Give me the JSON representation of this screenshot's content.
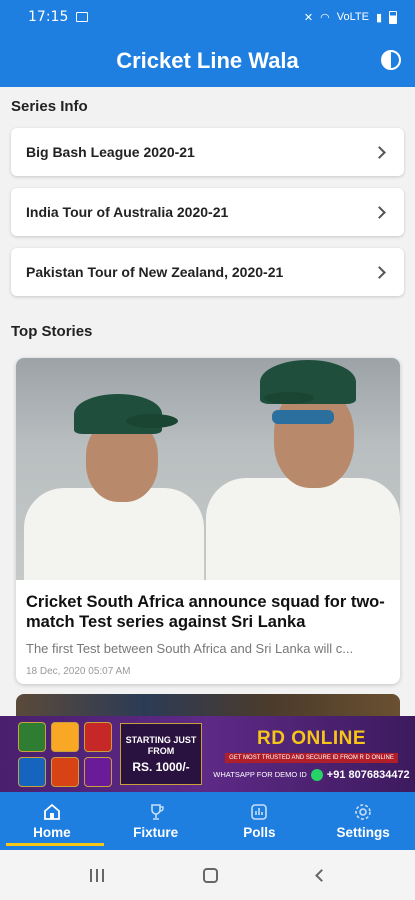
{
  "status_bar": {
    "time": "17:15",
    "network": "VoLTE",
    "battery_icon": "battery-icon"
  },
  "app": {
    "title": "Cricket Line Wala",
    "theme_toggle_icon": "contrast-icon"
  },
  "series_section": {
    "title": "Series Info",
    "items": [
      {
        "label": "Big Bash League 2020-21"
      },
      {
        "label": "India Tour of Australia 2020-21"
      },
      {
        "label": "Pakistan Tour of New Zealand, 2020-21"
      }
    ]
  },
  "stories_section": {
    "title": "Top Stories",
    "stories": [
      {
        "headline": "Cricket South Africa announce squad for two-match Test series against Sri Lanka",
        "summary": "The first Test between South Africa and Sri Lanka will c...",
        "date": "18 Dec, 2020  05:07 AM"
      }
    ]
  },
  "ad": {
    "mid_line1": "STARTING JUST",
    "mid_line2": "FROM",
    "price": "RS. 1000/-",
    "brand": "RD ONLINE",
    "tagline": "GET MOST TRUSTED AND SECURE ID FROM R D ONLINE",
    "whatsapp_label": "WHATSAPP FOR DEMO ID",
    "phone": "+91 8076834472"
  },
  "bottom_nav": {
    "items": [
      {
        "label": "Home",
        "icon": "home-icon",
        "active": true
      },
      {
        "label": "Fixture",
        "icon": "trophy-icon",
        "active": false
      },
      {
        "label": "Polls",
        "icon": "poll-icon",
        "active": false
      },
      {
        "label": "Settings",
        "icon": "gear-icon",
        "active": false
      }
    ]
  },
  "colors": {
    "primary": "#1f7fe0",
    "accent_underline": "#f5c518",
    "background": "#f2f2f2"
  }
}
